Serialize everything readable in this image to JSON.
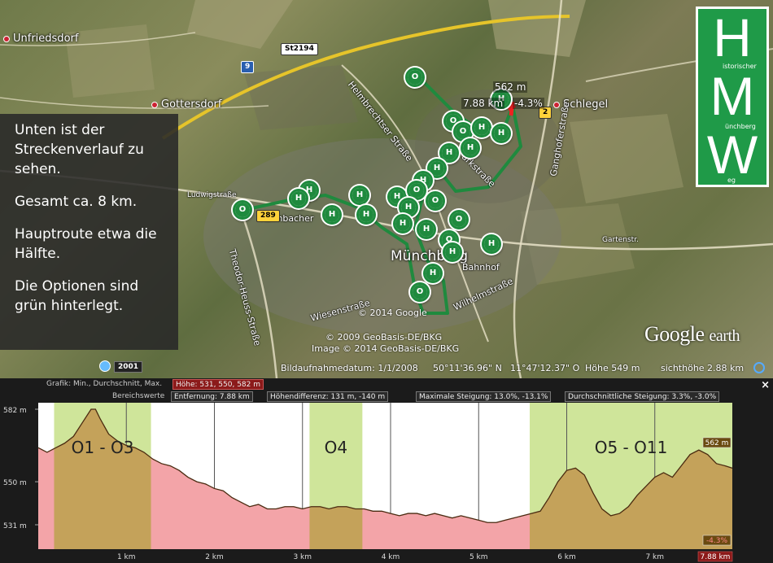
{
  "map": {
    "towns": [
      {
        "name": "Unfriedsdorf"
      },
      {
        "name": "Gottersdorf"
      },
      {
        "name": "Schlegel"
      },
      {
        "name": "Münchberg"
      }
    ],
    "streets": [
      "Helmbrechtser Straße",
      "Parkstraße",
      "Ganghoferstraße",
      "Theodor-Heuss-Straße",
      "Wiesenstraße",
      "Kulmbacher",
      "Wilhelmstraße",
      "Bahnhof",
      "Ludwigstraße",
      "Gartenstr."
    ],
    "road_shields": [
      {
        "label": "9",
        "style": "blue"
      },
      {
        "label": "St2194",
        "style": "white"
      },
      {
        "label": "2",
        "style": "yellow"
      },
      {
        "label": "289",
        "style": "yellow"
      }
    ],
    "marker_letters": {
      "h": "H",
      "o": "O"
    },
    "callout": {
      "elevation": "562 m",
      "distance": "7.88 km",
      "grade": "-4.3%"
    },
    "copyrights": [
      "© 2014 Google",
      "© 2009 GeoBasis-DE/BKG",
      "Image © 2014 GeoBasis-DE/BKG"
    ],
    "logo": {
      "google": "Google",
      "earth": "earth"
    },
    "status": {
      "year": "2001",
      "image_date": "Bildaufnahmedatum: 1/1/2008",
      "lat": "50°11'36.96\" N",
      "lon": "11°47'12.37\" O",
      "elevation": "Höhe   549 m",
      "eye_alt": "sichthöhe   2.88 km"
    },
    "route_color": "#1f8a3e"
  },
  "info_box": {
    "lines": [
      "Unten ist der Streckenverlauf zu sehen.",
      "Gesamt ca. 8 km.",
      "Hauptroute etwa die Hälfte.",
      "Die Optionen sind grün hinterlegt."
    ]
  },
  "hmw_logo": {
    "letters": [
      "H",
      "M",
      "W"
    ],
    "words": [
      "istorischer",
      "ünchberg",
      "eg"
    ],
    "color": "#1f9a48"
  },
  "profile": {
    "row1": {
      "label": "Grafik: Min., Durchschnitt, Max.",
      "highlight": "Höhe: 531, 550, 582 m"
    },
    "row2": {
      "label": "Bereichswerte",
      "distance": "Entfernung: 7.88 km",
      "height_diff": "Höhendifferenz: 131 m, -140 m",
      "max_grade": "Maximale Steigung: 13.0%, -13.1%",
      "avg_grade": "Durchschnittliche Steigung: 3.3%, -3.0%"
    },
    "close": "×",
    "end_marker": {
      "elevation": "562 m",
      "distance": "7.88 km",
      "grade": "-4.3%"
    }
  },
  "chart_data": {
    "type": "area",
    "title": "",
    "xlabel": "",
    "ylabel": "",
    "xlim": [
      0,
      7.88
    ],
    "ylim": [
      531,
      582
    ],
    "y_ticks": [
      {
        "value": 582,
        "label": "582 m"
      },
      {
        "value": 550,
        "label": "550 m"
      },
      {
        "value": 531,
        "label": "531 m"
      }
    ],
    "x_ticks": [
      {
        "value": 1,
        "label": "1 km"
      },
      {
        "value": 2,
        "label": "2 km"
      },
      {
        "value": 3,
        "label": "3 km"
      },
      {
        "value": 4,
        "label": "4 km"
      },
      {
        "value": 5,
        "label": "5 km"
      },
      {
        "value": 6,
        "label": "6 km"
      },
      {
        "value": 7,
        "label": "7 km"
      }
    ],
    "x": [
      0,
      0.1,
      0.2,
      0.3,
      0.4,
      0.5,
      0.6,
      0.65,
      0.7,
      0.8,
      0.9,
      1.0,
      1.1,
      1.2,
      1.3,
      1.4,
      1.5,
      1.6,
      1.7,
      1.8,
      1.9,
      2.0,
      2.1,
      2.2,
      2.3,
      2.4,
      2.5,
      2.6,
      2.7,
      2.8,
      2.9,
      3.0,
      3.1,
      3.2,
      3.3,
      3.4,
      3.5,
      3.6,
      3.7,
      3.8,
      3.9,
      4.0,
      4.1,
      4.2,
      4.3,
      4.4,
      4.5,
      4.6,
      4.7,
      4.8,
      4.9,
      5.0,
      5.1,
      5.2,
      5.3,
      5.4,
      5.5,
      5.6,
      5.7,
      5.8,
      5.9,
      6.0,
      6.1,
      6.2,
      6.3,
      6.4,
      6.5,
      6.6,
      6.7,
      6.8,
      6.9,
      7.0,
      7.1,
      7.2,
      7.3,
      7.4,
      7.5,
      7.6,
      7.7,
      7.8,
      7.88
    ],
    "series": [
      {
        "values": [
          565,
          563,
          565,
          567,
          570,
          576,
          582,
          582,
          578,
          571,
          568,
          566,
          565,
          563,
          560,
          558,
          557,
          555,
          552,
          550,
          549,
          547,
          546,
          543,
          541,
          539,
          540,
          538,
          538,
          539,
          539,
          538,
          539,
          539,
          538,
          539,
          539,
          538,
          538,
          537,
          537,
          536,
          535,
          536,
          536,
          535,
          536,
          535,
          534,
          535,
          534,
          533,
          532,
          532,
          533,
          534,
          535,
          536,
          537,
          543,
          550,
          555,
          556,
          553,
          545,
          538,
          535,
          536,
          539,
          544,
          548,
          552,
          554,
          552,
          557,
          562,
          564,
          562,
          558,
          557,
          556
        ]
      }
    ],
    "highlight_bands": [
      {
        "label": "O1 - O3",
        "from": 0.18,
        "to": 1.28
      },
      {
        "label": "O4",
        "from": 3.08,
        "to": 3.68
      },
      {
        "label": "O5 - O11",
        "from": 5.58,
        "to": 7.88
      }
    ],
    "colors": {
      "fill_low": "#f3a4a8",
      "band": "#cfe59a",
      "line": "#4a2a10",
      "background": "#ffffff"
    }
  }
}
